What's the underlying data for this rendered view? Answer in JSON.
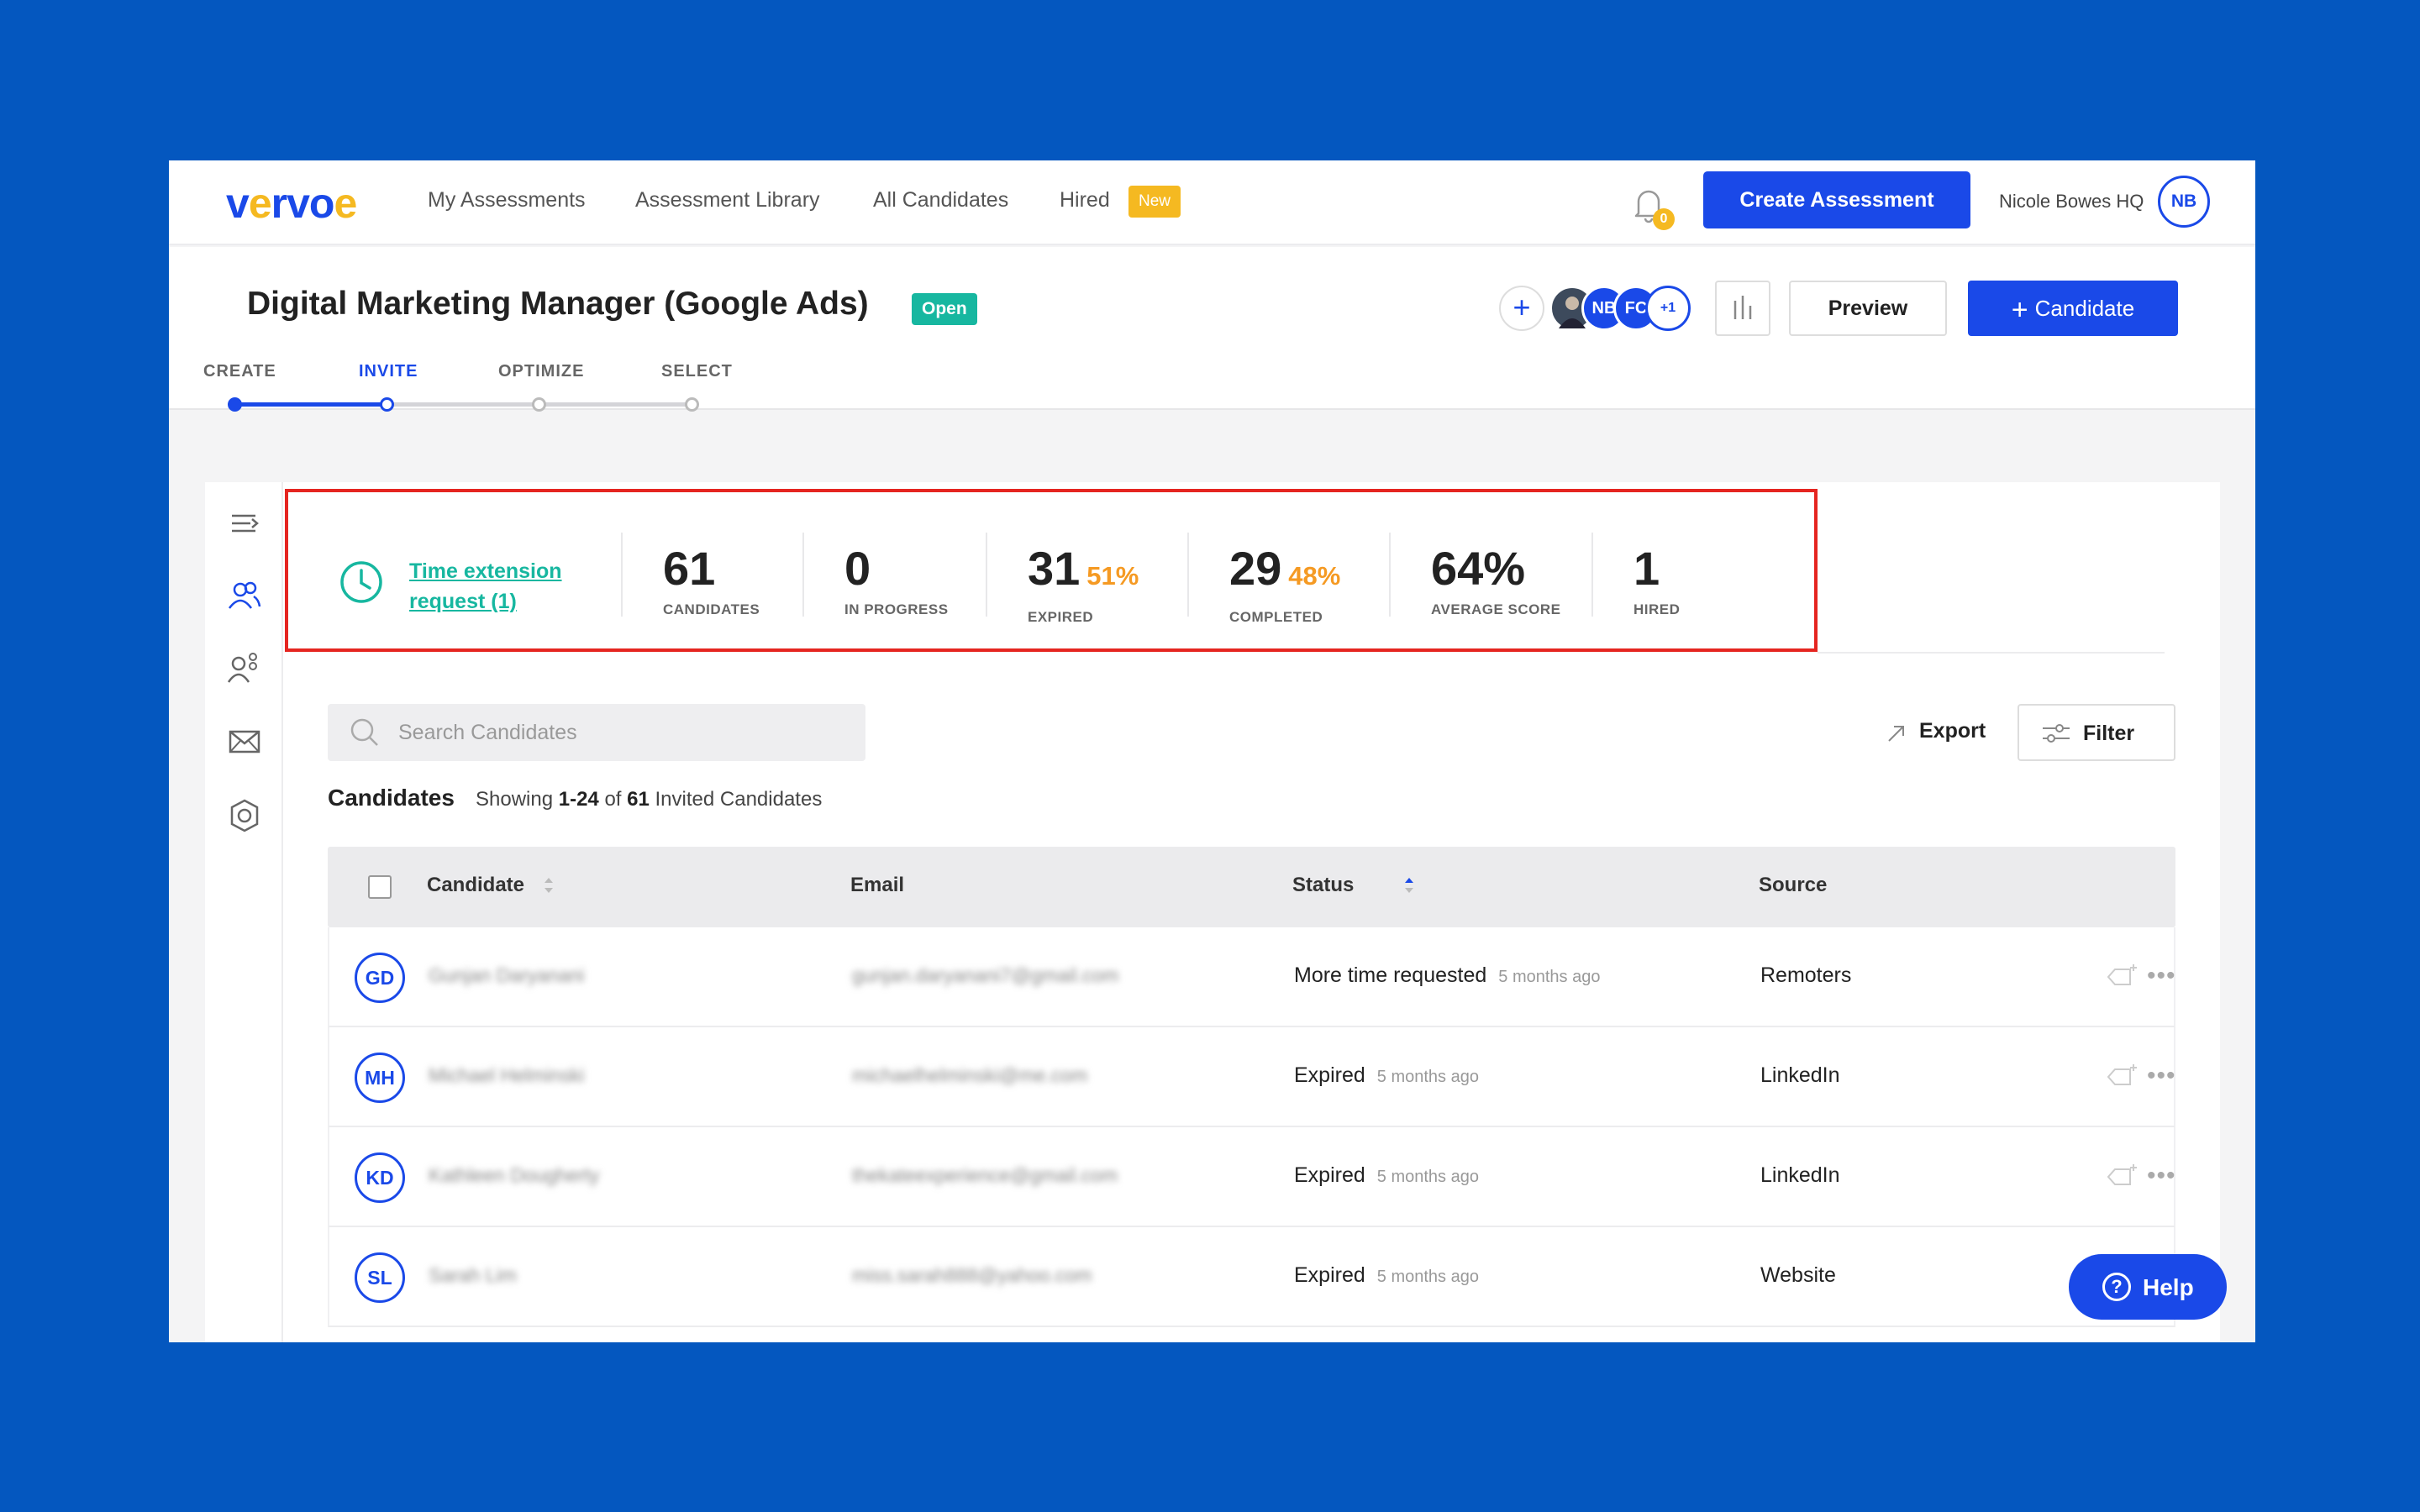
{
  "nav": {
    "logo": [
      "v",
      "e",
      "r",
      "v",
      "o",
      "e"
    ],
    "links": [
      "My Assessments",
      "Assessment Library",
      "All Candidates",
      "Hired"
    ],
    "new_badge": "New",
    "notif_count": "0",
    "create_btn": "Create Assessment",
    "user_name": "Nicole Bowes HQ",
    "user_initials": "NB"
  },
  "header": {
    "title": "Digital Marketing Manager (Google Ads)",
    "status_badge": "Open",
    "collaborators": [
      "",
      "NB",
      "FC",
      "+1"
    ],
    "preview_btn": "Preview",
    "candidate_btn": "Candidate",
    "steps": [
      "CREATE",
      "INVITE",
      "OPTIMIZE",
      "SELECT"
    ],
    "active_step": "INVITE"
  },
  "stats": {
    "time_extension": "Time extension request (1)",
    "items": [
      {
        "num": "61",
        "pct": "",
        "label": "CANDIDATES"
      },
      {
        "num": "0",
        "pct": "",
        "label": "IN PROGRESS"
      },
      {
        "num": "31",
        "pct": "51%",
        "label": "EXPIRED"
      },
      {
        "num": "29",
        "pct": "48%",
        "label": "COMPLETED"
      },
      {
        "num": "64%",
        "pct": "",
        "label": "AVERAGE SCORE"
      },
      {
        "num": "1",
        "pct": "",
        "label": "HIRED"
      }
    ]
  },
  "toolbar": {
    "search_placeholder": "Search Candidates",
    "export": "Export",
    "filter": "Filter"
  },
  "list": {
    "title": "Candidates",
    "showing_prefix": "Showing",
    "showing_range": "1-24",
    "showing_of": "of",
    "showing_total": "61",
    "showing_suffix": "Invited Candidates"
  },
  "table": {
    "columns": [
      "Candidate",
      "Email",
      "Status",
      "Source"
    ],
    "rows": [
      {
        "initials": "GD",
        "name": "Gunjan Daryanani",
        "email": "gunjan.daryanani7@gmail.com",
        "status": "More time requested",
        "ago": "5 months ago",
        "source": "Remoters"
      },
      {
        "initials": "MH",
        "name": "Michael Helminski",
        "email": "michaelhelminski@me.com",
        "status": "Expired",
        "ago": "5 months ago",
        "source": "LinkedIn"
      },
      {
        "initials": "KD",
        "name": "Kathleen Dougherty",
        "email": "thekateexperience@gmail.com",
        "status": "Expired",
        "ago": "5 months ago",
        "source": "LinkedIn"
      },
      {
        "initials": "SL",
        "name": "Sarah Lim",
        "email": "miss.sarah888@yahoo.com",
        "status": "Expired",
        "ago": "5 months ago",
        "source": "Website"
      }
    ]
  },
  "help": "Help",
  "colors": {
    "primary": "#1A49E8",
    "teal": "#17B7A0",
    "orange": "#F59A23",
    "yellow": "#F5B921",
    "highlight": "#E52520",
    "background": "#0457BF"
  }
}
